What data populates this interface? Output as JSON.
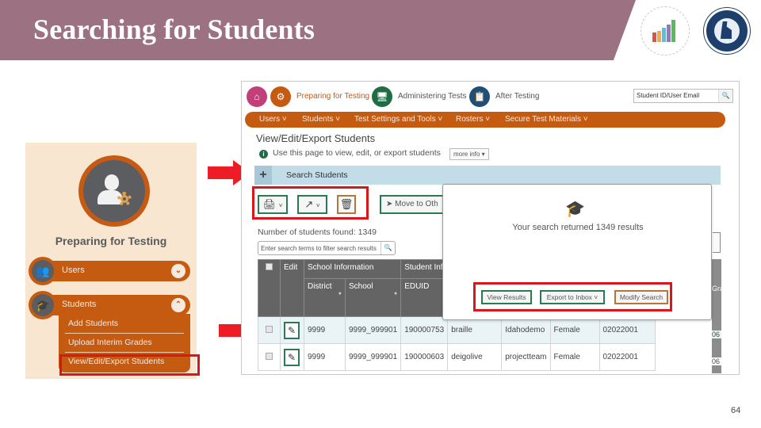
{
  "slide": {
    "title": "Searching for Students",
    "page_number": "64",
    "banner_color": "#9c7182",
    "logos": [
      "idaho-comprehensive-assessment-logo",
      "idaho-department-of-education-seal"
    ]
  },
  "left_panel": {
    "section_icon": "user-gear-icon",
    "section_title": "Preparing for Testing",
    "menus": [
      {
        "label": "Users",
        "icon": "users-icon",
        "expanded": false
      },
      {
        "label": "Students",
        "icon": "graduation-cap-icon",
        "expanded": true,
        "items": [
          "Add Students",
          "Upload Interim Grades",
          "View/Edit/Export Students"
        ]
      }
    ],
    "highlighted_item": "View/Edit/Export Students",
    "accent_color": "#c55a11"
  },
  "app": {
    "tabs": [
      {
        "label": "Preparing for Testing",
        "icon": "user-gear-icon",
        "active": true,
        "color": "#c55a11"
      },
      {
        "label": "Administering Tests",
        "icon": "monitor-user-icon",
        "active": false,
        "color": "#1f6e43"
      },
      {
        "label": "After Testing",
        "icon": "report-icon",
        "active": false,
        "color": "#1f4e79"
      }
    ],
    "home_icon": "home-icon",
    "site_search": {
      "placeholder": "Student ID/User Email",
      "icon": "search-icon"
    },
    "menu": [
      "Users",
      "Students",
      "Test Settings and Tools",
      "Rosters",
      "Secure Test Materials"
    ],
    "page_title": "View/Edit/Export Students",
    "info_text": "Use this page to view, edit, or export students",
    "more_info": "more info",
    "search_panel_label": "Search Students",
    "toolbar": {
      "print_icon": "printer-icon",
      "export_icon": "export-icon",
      "delete_icon": "trash-icon",
      "move_label": "Move to Oth"
    },
    "count_label": "Number of students found: 1349",
    "filter_placeholder": "Enter search terms to filter search results",
    "table": {
      "group_headers": [
        "School Information",
        "Student Inf"
      ],
      "columns": [
        "Edit",
        "District",
        "School",
        "EDUID"
      ],
      "partial_right_header": "Gra",
      "rows": [
        {
          "district": "9999",
          "school": "9999_999901",
          "eduid": "190000753",
          "c4": "braille",
          "c5": "Idahodemo",
          "c6": "",
          "gender": "Female",
          "dob": "02022001",
          "grade": "06"
        },
        {
          "district": "9999",
          "school": "9999_999901",
          "eduid": "190000603",
          "c4": "deigolive",
          "c5": "projectteam",
          "c6": "",
          "gender": "Female",
          "dob": "02022001",
          "grade": "06"
        }
      ]
    },
    "modal": {
      "icon": "graduation-cap-icon",
      "message": "Your search returned 1349 results",
      "buttons": [
        "View Results",
        "Export to Inbox",
        "Modify Search"
      ]
    }
  }
}
